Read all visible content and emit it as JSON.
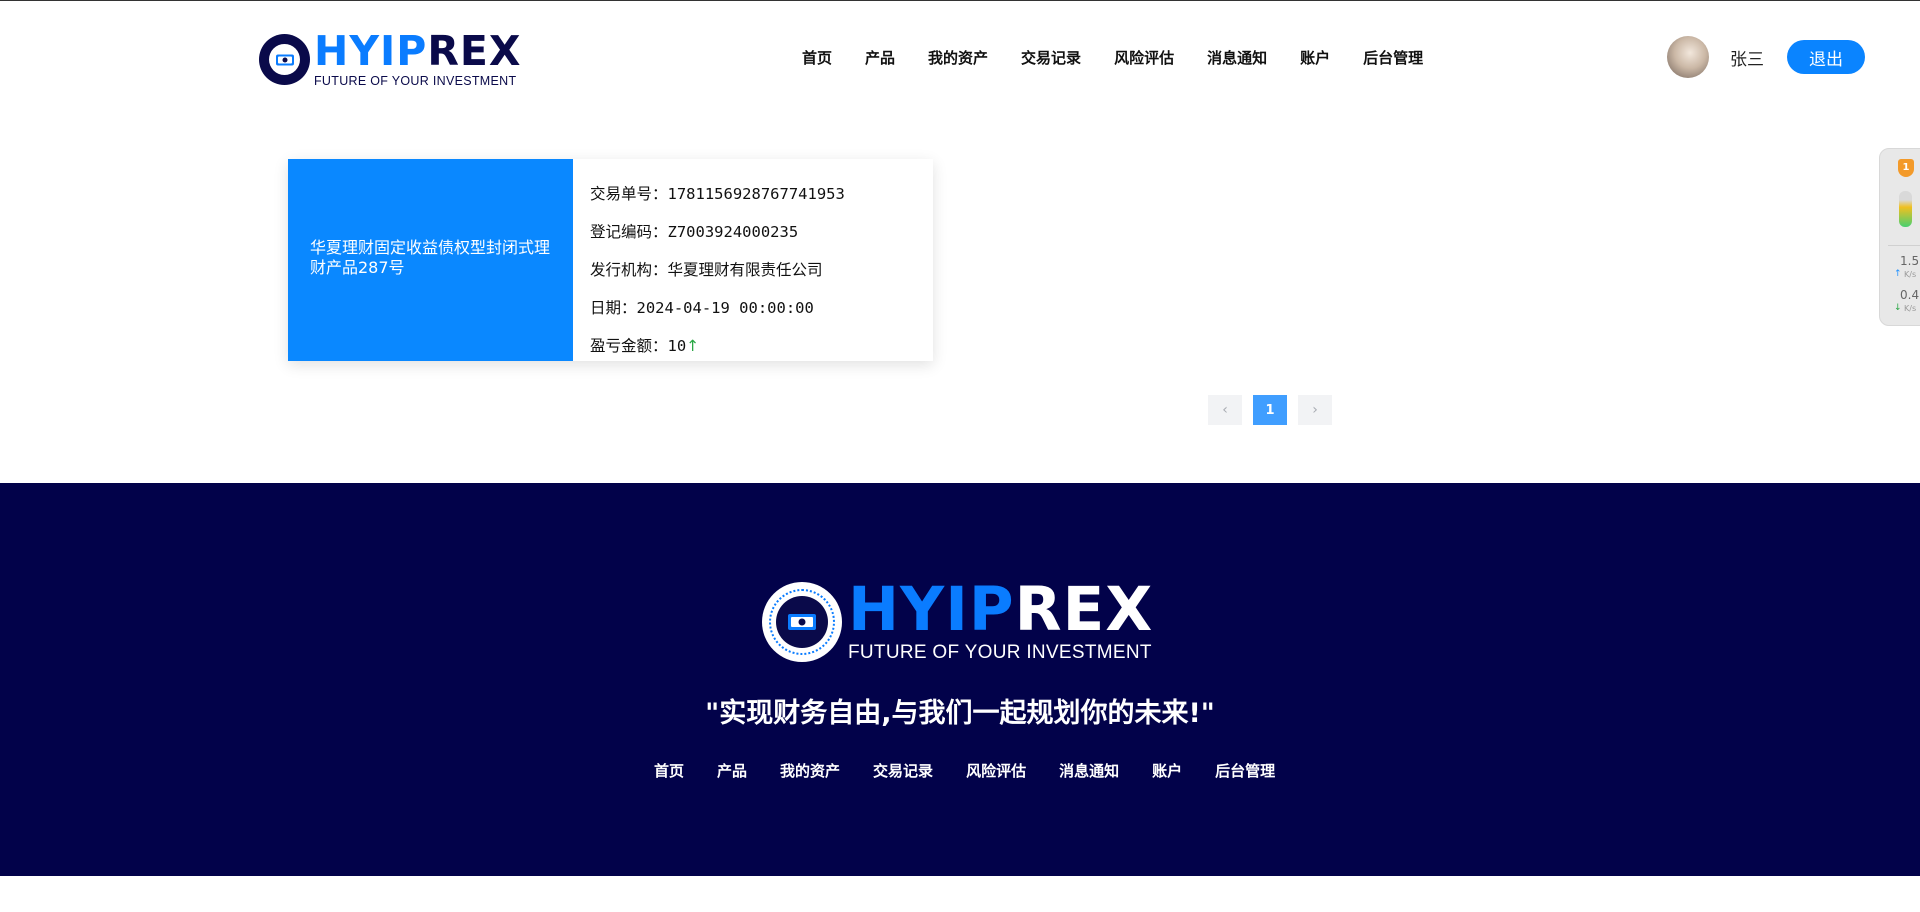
{
  "brand": {
    "name_part1": "HYIP",
    "name_part2": "REX",
    "tagline": "FUTURE OF YOUR INVESTMENT"
  },
  "nav": [
    "首页",
    "产品",
    "我的资产",
    "交易记录",
    "风险评估",
    "消息通知",
    "账户",
    "后台管理"
  ],
  "user": {
    "name": "张三",
    "logout_label": "退出"
  },
  "record": {
    "product_name": "华夏理财固定收益债权型封闭式理财产品287号",
    "order_no_label": "交易单号：",
    "order_no": "1781156928767741953",
    "reg_code_label": "登记编码：",
    "reg_code": "Z7003924000235",
    "issuer_label": "发行机构：",
    "issuer": "华夏理财有限责任公司",
    "date_label": "日期：",
    "date": "2024-04-19 00:00:00",
    "pnl_label": "盈亏金额：",
    "pnl": "10",
    "pnl_trend": "↑"
  },
  "pagination": {
    "prev": "‹",
    "current": "1",
    "next": "›"
  },
  "widget": {
    "badge": "1",
    "upload_speed": "1.5",
    "download_speed": "0.4",
    "unit": "K/s",
    "up_arrow": "↑",
    "down_arrow": "↓"
  },
  "footer": {
    "slogan": "\"实现财务自由,与我们一起规划你的未来!\""
  },
  "colors": {
    "accent": "#0a88ff",
    "footer_bg": "#02024a",
    "brand_dark": "#0a0a4a",
    "pager_active": "#409eff",
    "trend_up": "#2aa745"
  }
}
